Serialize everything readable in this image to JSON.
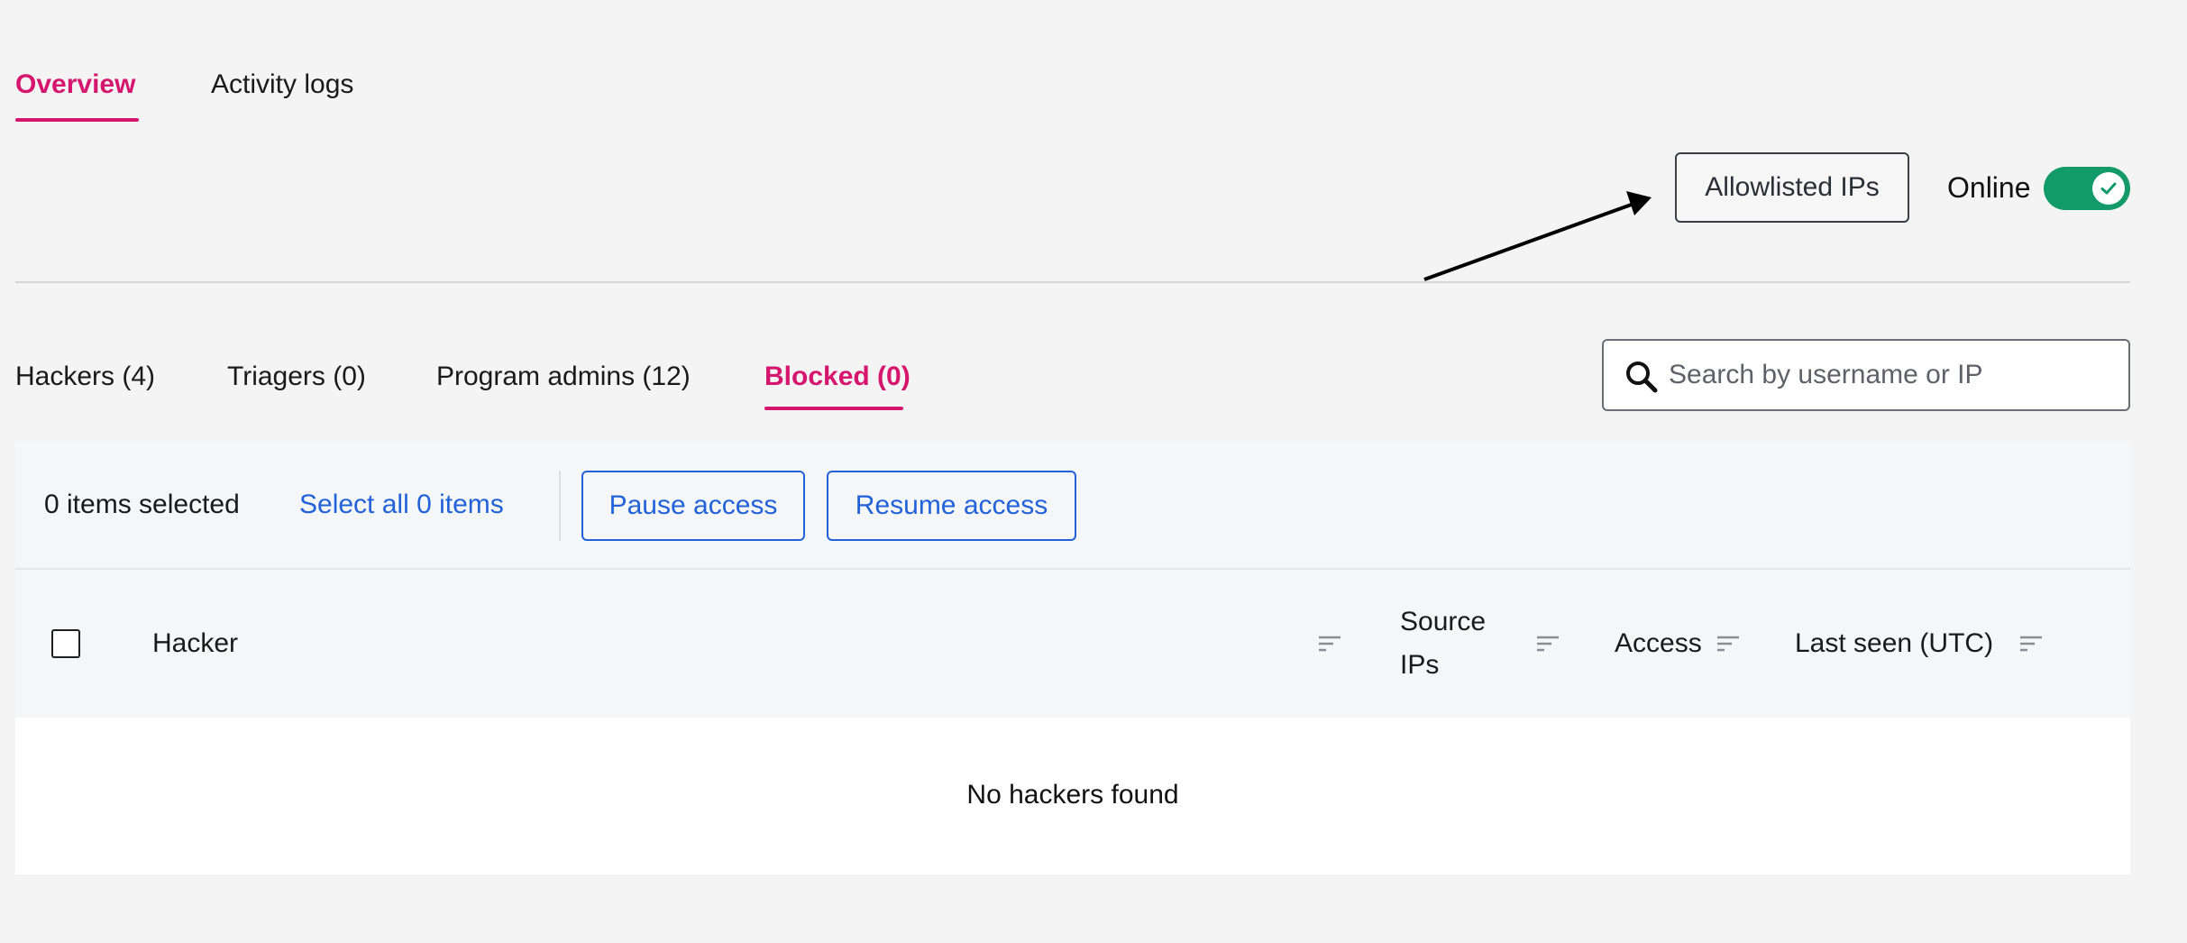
{
  "top_tabs": [
    {
      "label": "Overview",
      "active": true
    },
    {
      "label": "Activity logs",
      "active": false
    }
  ],
  "header_actions": {
    "allowlisted_label": "Allowlisted IPs",
    "online_label": "Online",
    "online_on": true
  },
  "sub_tabs": [
    {
      "label": "Hackers (4)",
      "active": false
    },
    {
      "label": "Triagers (0)",
      "active": false
    },
    {
      "label": "Program admins (12)",
      "active": false
    },
    {
      "label": "Blocked (0)",
      "active": true
    }
  ],
  "search": {
    "placeholder": "Search by username or IP",
    "value": ""
  },
  "selection": {
    "count_label": "0 items selected",
    "select_all_label": "Select all 0 items",
    "pause_label": "Pause access",
    "resume_label": "Resume access"
  },
  "table": {
    "columns": [
      {
        "label": "Hacker"
      },
      {
        "label": "Source IPs"
      },
      {
        "label": "Access"
      },
      {
        "label": "Last seen (UTC)"
      }
    ],
    "empty_message": "No hackers found"
  },
  "colors": {
    "accent": "#d6166e",
    "link": "#2162d9",
    "toggle_on": "#129a6a",
    "background": "#f4f4f4"
  },
  "icons": {
    "search": "search-icon",
    "sort": "sort-lines-icon",
    "toggle_check": "check-icon"
  }
}
